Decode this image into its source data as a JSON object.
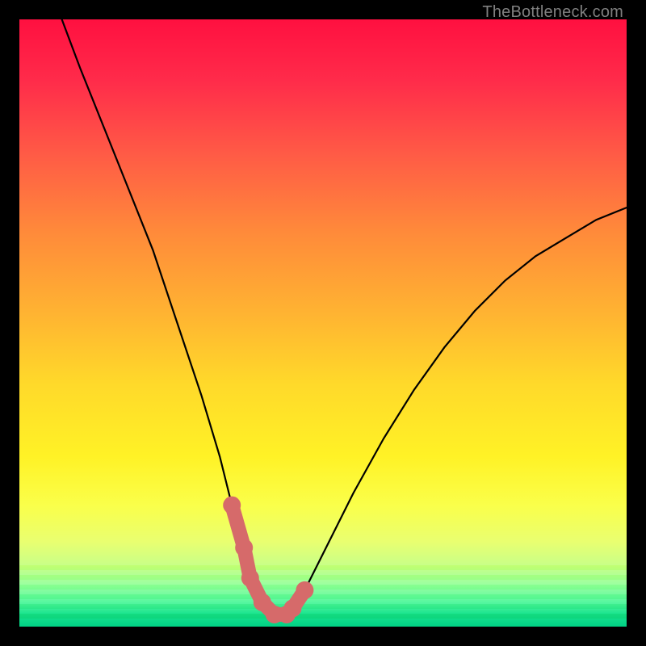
{
  "watermark": "TheBottleneck.com",
  "colors": {
    "frame": "#000000",
    "curve": "#000000",
    "thick_segment": "#d66a6a",
    "watermark_text": "#808080"
  },
  "chart_data": {
    "type": "line",
    "title": "",
    "xlabel": "",
    "ylabel": "",
    "xlim": [
      0,
      100
    ],
    "ylim": [
      0,
      100
    ],
    "series": [
      {
        "name": "bottleneck-curve",
        "x": [
          7,
          10,
          14,
          18,
          22,
          26,
          30,
          33,
          35,
          37,
          38,
          40,
          42,
          44,
          45,
          47,
          50,
          55,
          60,
          65,
          70,
          75,
          80,
          85,
          90,
          95,
          100
        ],
        "y": [
          100,
          92,
          82,
          72,
          62,
          50,
          38,
          28,
          20,
          13,
          8,
          4,
          2,
          2,
          3,
          6,
          12,
          22,
          31,
          39,
          46,
          52,
          57,
          61,
          64,
          67,
          69
        ]
      }
    ],
    "annotations": [
      {
        "name": "optimal-zone",
        "x_range": [
          35,
          47
        ],
        "style": "thick-coral"
      }
    ]
  }
}
